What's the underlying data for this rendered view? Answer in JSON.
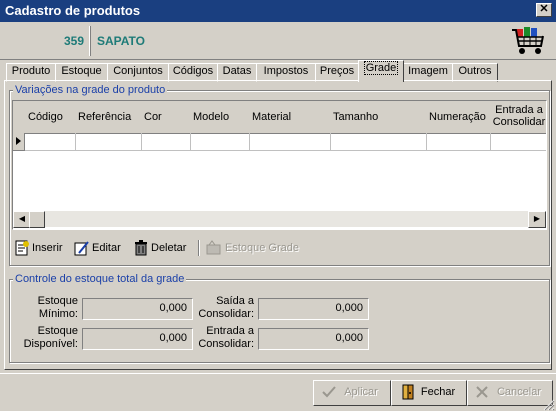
{
  "window": {
    "title": "Cadastro de produtos",
    "close_glyph": "✕"
  },
  "product": {
    "code": "359",
    "name": "SAPATO"
  },
  "tabs": [
    {
      "label": "Produto"
    },
    {
      "label": "Estoque"
    },
    {
      "label": "Conjuntos"
    },
    {
      "label": "Códigos"
    },
    {
      "label": "Datas"
    },
    {
      "label": "Impostos"
    },
    {
      "label": "Preços"
    },
    {
      "label": "Grade",
      "active": true
    },
    {
      "label": "Imagem"
    },
    {
      "label": "Outros"
    }
  ],
  "variations": {
    "title": "Variações na grade do produto",
    "columns": [
      "Código",
      "Referência",
      "Cor",
      "Modelo",
      "Material",
      "Tamanho",
      "Numeração",
      "Entrada a Consolidar"
    ]
  },
  "toolbar": {
    "insert": "Inserir",
    "edit": "Editar",
    "delete": "Deletar",
    "stock_grid": "Estoque Grade"
  },
  "stock_control": {
    "title": "Controle do estoque total da grade",
    "min_label": "Estoque Mínimo:",
    "min_value": "0,000",
    "available_label": "Estoque Disponível:",
    "available_value": "0,000",
    "exit_label": "Saída a Consolidar:",
    "exit_value": "0,000",
    "entry_label": "Entrada a Consolidar:",
    "entry_value": "0,000"
  },
  "buttons": {
    "apply": "Aplicar",
    "close": "Fechar",
    "cancel": "Cancelar"
  }
}
